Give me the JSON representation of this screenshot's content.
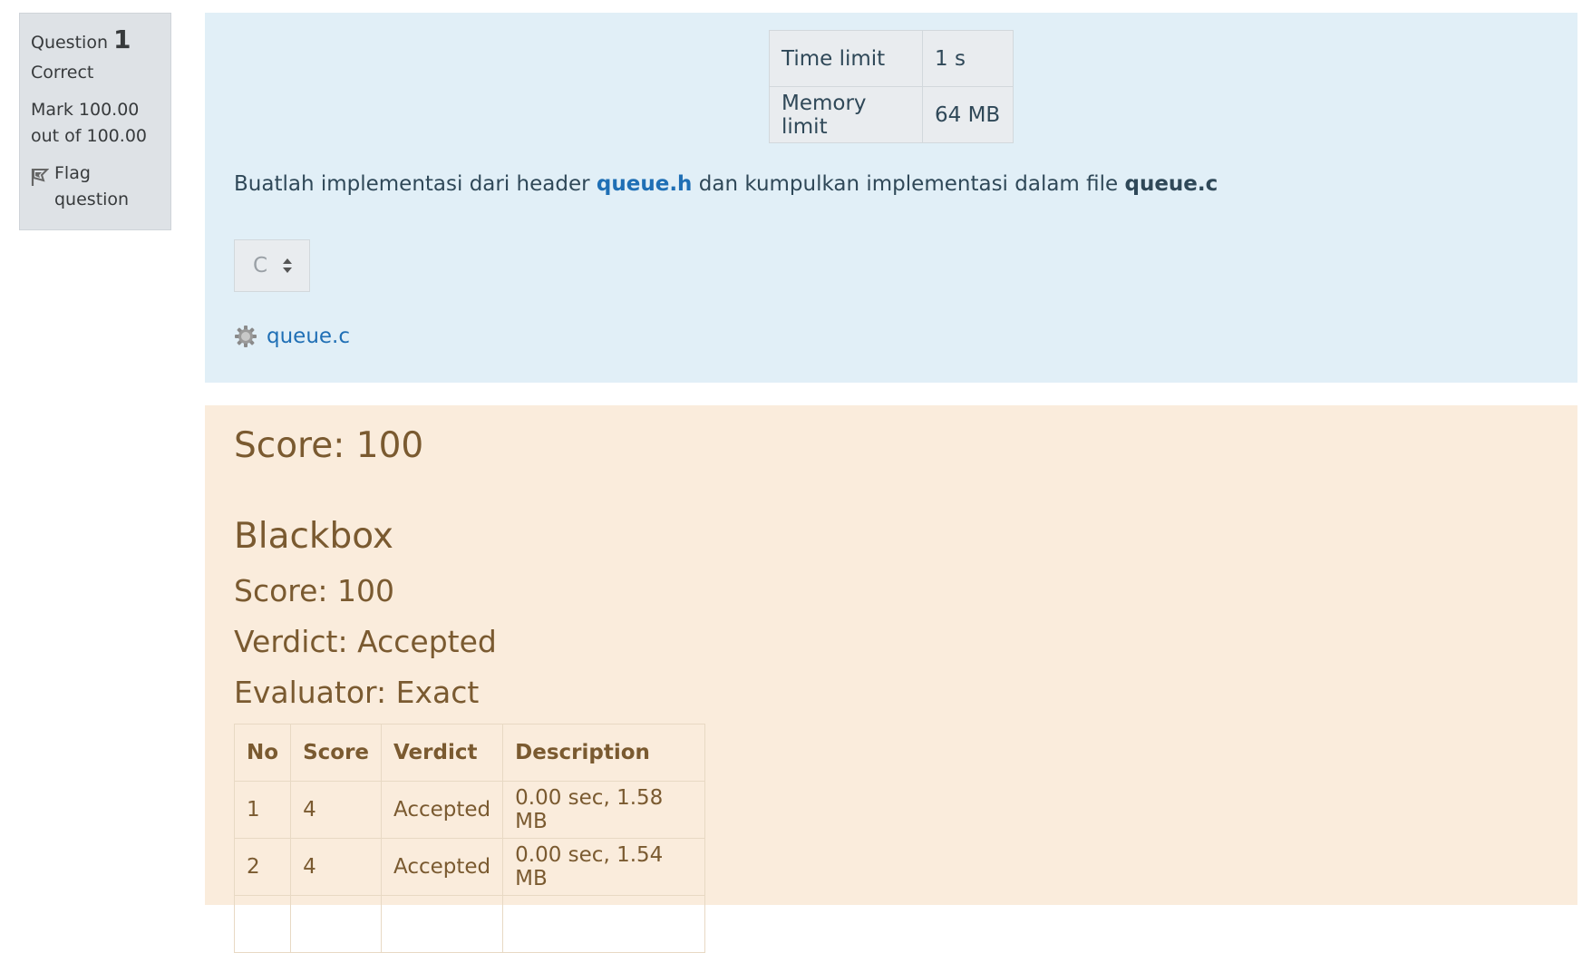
{
  "question_info": {
    "label": "Question",
    "number": "1",
    "state": "Correct",
    "grade_line1": "Mark 100.00",
    "grade_line2": "out of 100.00",
    "flag_line1": "Flag",
    "flag_line2": "question",
    "flag_icon": "flag-icon"
  },
  "limits": [
    {
      "key": "Time limit",
      "value": "1 s"
    },
    {
      "key": "Memory limit",
      "value": "64 MB"
    }
  ],
  "question_text": {
    "part1": "Buatlah implementasi dari header ",
    "header_link": "queue.h",
    "part2": " dan kumpulkan implementasi dalam file ",
    "file_name": "queue.c"
  },
  "language_select": {
    "selected": "C"
  },
  "attachment": {
    "icon": "gear-icon",
    "label": "queue.c"
  },
  "feedback": {
    "score_heading": "Score: 100",
    "group_title": "Blackbox",
    "group_score": "Score: 100",
    "verdict": "Verdict: Accepted",
    "evaluator": "Evaluator: Exact",
    "table": {
      "headers": [
        "No",
        "Score",
        "Verdict",
        "Description"
      ],
      "rows": [
        [
          "1",
          "4",
          "Accepted",
          "0.00 sec, 1.58 MB"
        ],
        [
          "2",
          "4",
          "Accepted",
          "0.00 sec, 1.54 MB"
        ]
      ]
    }
  },
  "colors": {
    "info_bg": "#dee2e6",
    "formulation_bg": "#e1eff7",
    "feedback_bg": "#faecdc",
    "link": "#1f6fb5",
    "feedback_text": "#7a5a30"
  }
}
